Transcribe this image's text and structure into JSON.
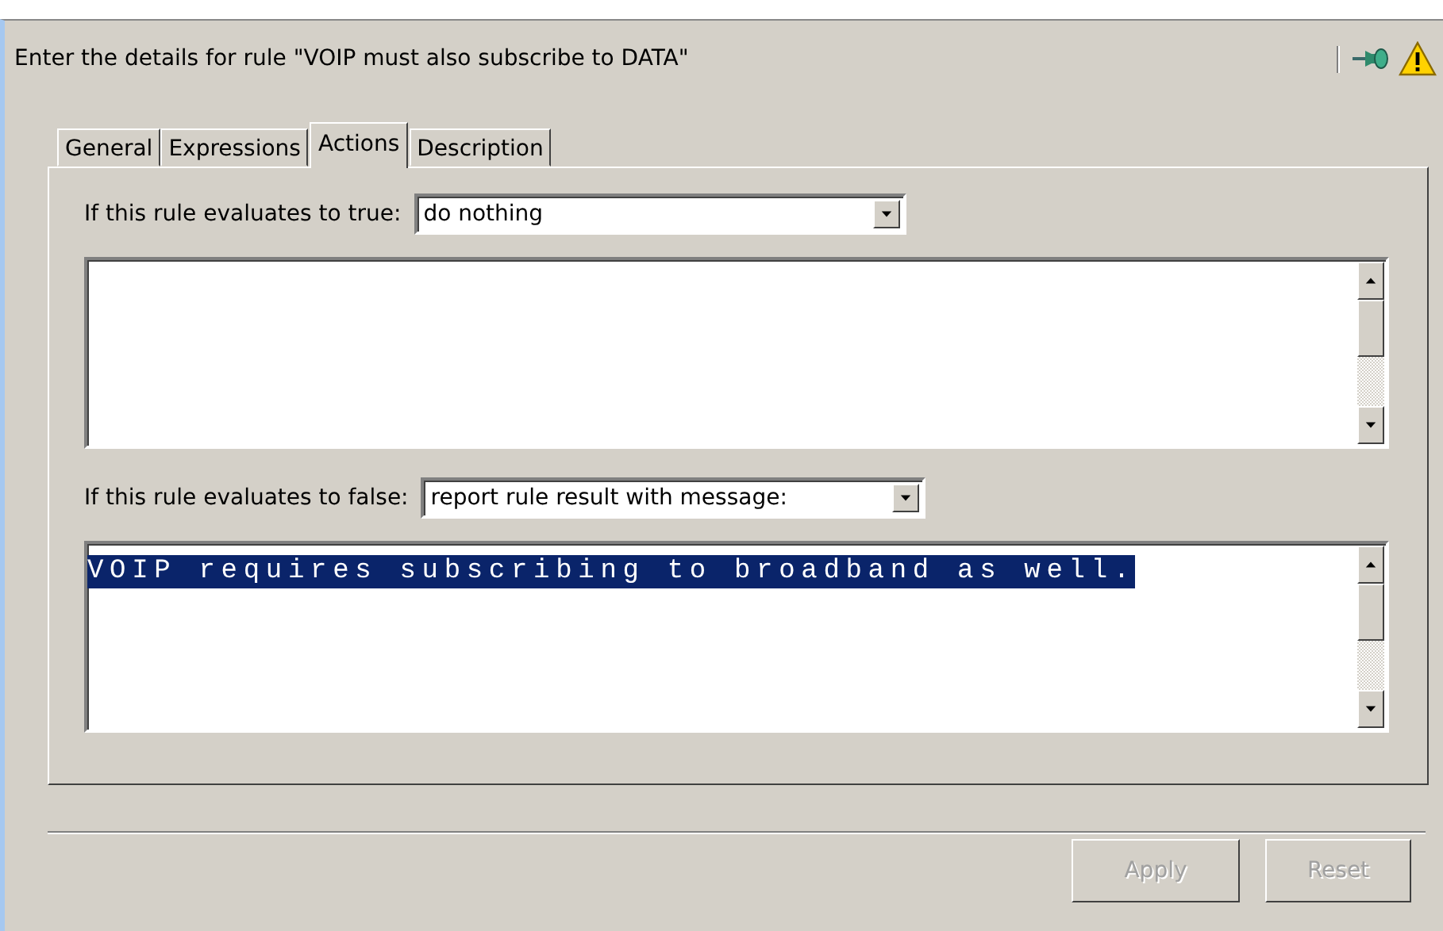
{
  "header": {
    "title": "Enter the details for rule \"VOIP must also subscribe to DATA\""
  },
  "tabs": [
    {
      "label": "General",
      "selected": false
    },
    {
      "label": "Expressions",
      "selected": false
    },
    {
      "label": "Actions",
      "selected": true
    },
    {
      "label": "Description",
      "selected": false
    }
  ],
  "actions": [
    {
      "label": "If this rule evaluates to true:",
      "value": "do nothing"
    },
    {
      "label": "If this rule evaluates to false:",
      "value": "report rule result with message:",
      "message": "VOIP requires subscribing to broadband as well.",
      "highlighted": true
    }
  ],
  "buttons": [
    {
      "label": "Apply",
      "disabled": true
    },
    {
      "label": "Reset",
      "disabled": true
    }
  ]
}
